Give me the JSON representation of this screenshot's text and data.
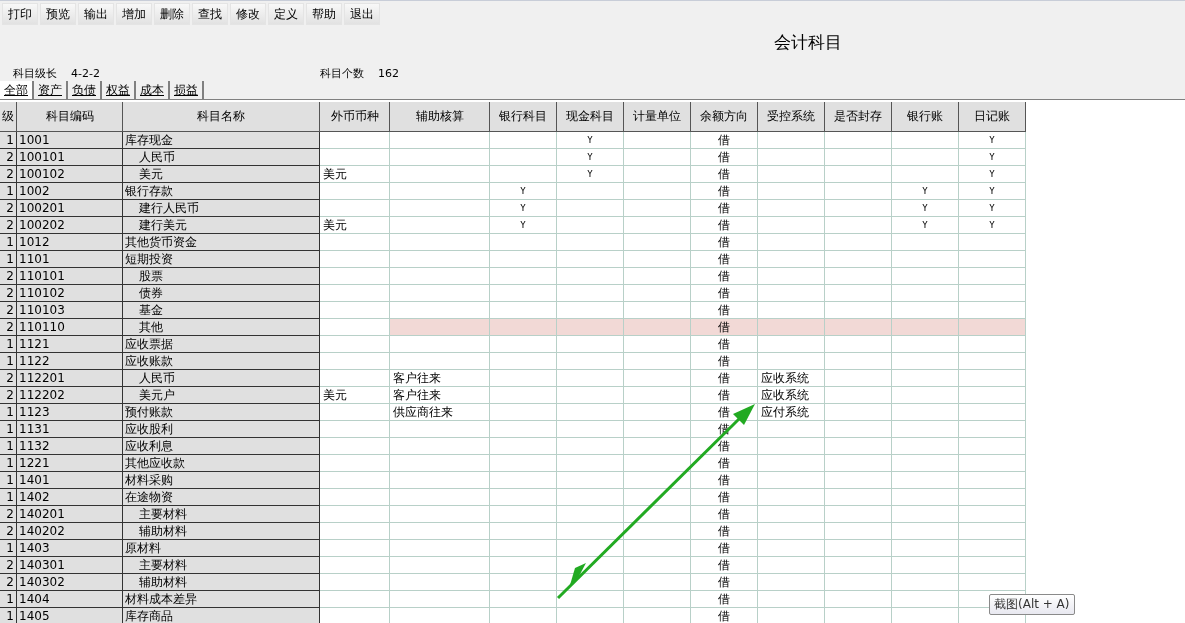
{
  "toolbar": [
    "打印",
    "预览",
    "输出",
    "增加",
    "删除",
    "查找",
    "修改",
    "定义",
    "帮助",
    "退出"
  ],
  "title": "会计科目",
  "info": {
    "level_label": "科目级长",
    "level_value": "4-2-2",
    "count_label": "科目个数",
    "count_value": "162"
  },
  "tabs": [
    {
      "label": "全部",
      "selected": true
    },
    {
      "label": "资产",
      "selected": false
    },
    {
      "label": "负债",
      "selected": false
    },
    {
      "label": "权益",
      "selected": false
    },
    {
      "label": "成本",
      "selected": false
    },
    {
      "label": "损益",
      "selected": false
    }
  ],
  "columns": [
    "级",
    "科目编码",
    "科目名称",
    "外币币种",
    "辅助核算",
    "银行科目",
    "现金科目",
    "计量单位",
    "余额方向",
    "受控系统",
    "是否封存",
    "银行账",
    "日记账"
  ],
  "rows": [
    {
      "level": "1",
      "code": "1001",
      "name": "库存现金",
      "cash": "Y",
      "direction": "借",
      "journal": "Y",
      "selected": false,
      "children": [
        {
          "level": "2",
          "code": "100101",
          "name": "人民币",
          "cash": "Y",
          "direction": "借",
          "journal": "Y",
          "selected": false
        },
        {
          "level": "2",
          "code": "100102",
          "name": "美元",
          "currency": "美元",
          "cash": "Y",
          "direction": "借",
          "journal": "Y",
          "selected": false
        }
      ]
    },
    {
      "level": "1",
      "code": "1002",
      "name": "银行存款",
      "bank": "Y",
      "direction": "借",
      "bankbook": "Y",
      "journal": "Y",
      "selected": false,
      "children": [
        {
          "level": "2",
          "code": "100201",
          "name": "建行人民币",
          "bank": "Y",
          "direction": "借",
          "bankbook": "Y",
          "journal": "Y",
          "selected": false
        },
        {
          "level": "2",
          "code": "100202",
          "name": "建行美元",
          "currency": "美元",
          "bank": "Y",
          "direction": "借",
          "bankbook": "Y",
          "journal": "Y",
          "selected": false
        }
      ]
    },
    {
      "level": "1",
      "code": "1012",
      "name": "其他货币资金",
      "direction": "借",
      "selected": false
    },
    {
      "level": "1",
      "code": "1101",
      "name": "短期投资",
      "direction": "借",
      "selected": false,
      "children": [
        {
          "level": "2",
          "code": "110101",
          "name": "股票",
          "direction": "借",
          "selected": false
        },
        {
          "level": "2",
          "code": "110102",
          "name": "债券",
          "direction": "借",
          "selected": false
        },
        {
          "level": "2",
          "code": "110103",
          "name": "基金",
          "direction": "借",
          "selected": false
        },
        {
          "level": "2",
          "code": "110110",
          "name": "其他",
          "direction": "借",
          "selected": true
        }
      ]
    },
    {
      "level": "1",
      "code": "1121",
      "name": "应收票据",
      "direction": "借",
      "selected": false
    },
    {
      "level": "1",
      "code": "1122",
      "name": "应收账款",
      "direction": "借",
      "selected": false,
      "children": [
        {
          "level": "2",
          "code": "112201",
          "name": "人民币",
          "aux": "客户往来",
          "direction": "借",
          "controlled": "应收系统",
          "selected": false
        },
        {
          "level": "2",
          "code": "112202",
          "name": "美元户",
          "currency": "美元",
          "aux": "客户往来",
          "direction": "借",
          "controlled": "应收系统",
          "selected": false
        }
      ]
    },
    {
      "level": "1",
      "code": "1123",
      "name": "预付账款",
      "aux": "供应商往来",
      "direction": "借",
      "controlled": "应付系统",
      "selected": false
    },
    {
      "level": "1",
      "code": "1131",
      "name": "应收股利",
      "direction": "借",
      "selected": false
    },
    {
      "level": "1",
      "code": "1132",
      "name": "应收利息",
      "direction": "借",
      "selected": false
    },
    {
      "level": "1",
      "code": "1221",
      "name": "其他应收款",
      "direction": "借",
      "selected": false
    },
    {
      "level": "1",
      "code": "1401",
      "name": "材料采购",
      "direction": "借",
      "selected": false
    },
    {
      "level": "1",
      "code": "1402",
      "name": "在途物资",
      "direction": "借",
      "selected": false,
      "children": [
        {
          "level": "2",
          "code": "140201",
          "name": "主要材料",
          "direction": "借",
          "selected": false
        },
        {
          "level": "2",
          "code": "140202",
          "name": "辅助材料",
          "direction": "借",
          "selected": false
        }
      ]
    },
    {
      "level": "1",
      "code": "1403",
      "name": "原材料",
      "direction": "借",
      "selected": false,
      "children": [
        {
          "level": "2",
          "code": "140301",
          "name": "主要材料",
          "direction": "借",
          "selected": false
        },
        {
          "level": "2",
          "code": "140302",
          "name": "辅助材料",
          "direction": "借",
          "selected": false
        }
      ]
    },
    {
      "level": "1",
      "code": "1404",
      "name": "材料成本差异",
      "direction": "借",
      "selected": false
    },
    {
      "level": "1",
      "code": "1405",
      "name": "库存商品",
      "direction": "借",
      "selected": false
    }
  ],
  "tooltip": "截图(Alt + A)"
}
